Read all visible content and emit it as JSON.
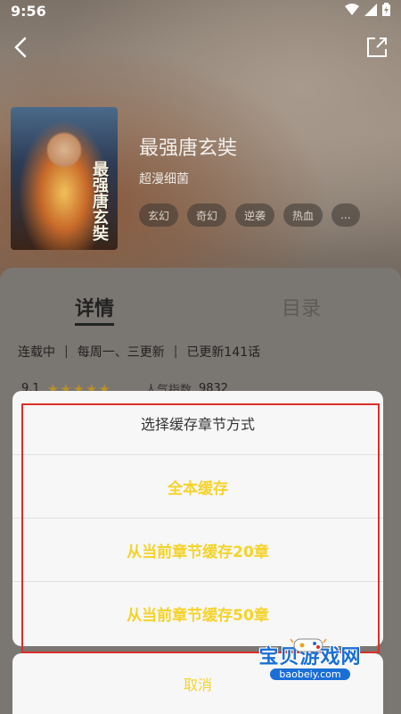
{
  "status_bar": {
    "time": "9:56"
  },
  "comic": {
    "title": "最强唐玄奘",
    "author": "超漫细菌",
    "cover_title": "最强唐玄奘",
    "tags": [
      "玄幻",
      "奇幻",
      "逆袭",
      "热血",
      "..."
    ]
  },
  "tabs": {
    "detail": "详情",
    "catalog": "目录"
  },
  "meta": {
    "status": "连载中",
    "schedule": "每周一、三更新",
    "updated": "已更新141话"
  },
  "rating": {
    "score": "9.1",
    "stars": "★★★★★",
    "popularity_label": "人气指数",
    "popularity_value": "9832"
  },
  "dialog": {
    "title": "选择缓存章节方式",
    "options": [
      "全本缓存",
      "从当前章节缓存20章",
      "从当前章节缓存50章"
    ],
    "cancel": "取消"
  },
  "watermark": {
    "text": "宝贝游戏网",
    "url": "baobeiy.com"
  },
  "colors": {
    "accent": "#f5d329",
    "highlight_border": "#d9302a",
    "watermark_blue": "#1a6fd6"
  }
}
